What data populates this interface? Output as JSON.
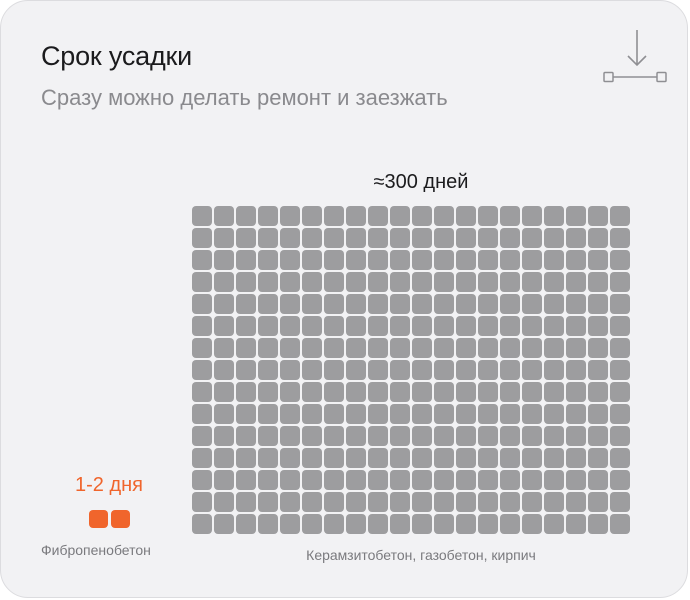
{
  "card": {
    "title": "Срок усадки",
    "subtitle": "Сразу можно делать ремонт и заезжать"
  },
  "icons": {
    "download": "download-icon"
  },
  "chart_data": {
    "type": "waffle",
    "series": [
      {
        "name": "Фибропенобетон",
        "value_label": "1-2 дня",
        "blocks": 2,
        "color": "#f0652c"
      },
      {
        "name": "Керамзитобетон, газобетон, кирпич",
        "value_label": "≈300 дней",
        "blocks": 300,
        "color": "#9d9d9f"
      }
    ]
  },
  "colors": {
    "accent": "#f0652c",
    "block_gray": "#9d9d9f",
    "card_bg": "#f2f2f4"
  }
}
